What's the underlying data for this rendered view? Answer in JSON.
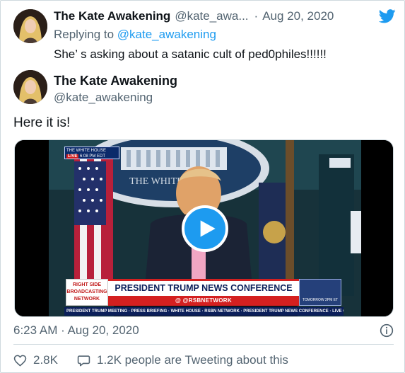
{
  "parent_tweet": {
    "display_name": "The Kate Awakening",
    "handle": "@kate_awa...",
    "separator": "·",
    "date": "Aug 20, 2020",
    "replying_label": "Replying to",
    "replying_to": "@kate_awakening",
    "text": "She’ s asking about a satanic cult of ped0philes!!!!!!"
  },
  "tweet": {
    "display_name": "The Kate Awakening",
    "handle": "@kate_awakening",
    "text": "Here it is!",
    "timestamp": "6:23 AM · Aug 20, 2020"
  },
  "video": {
    "corner_bug": "THE WHITE HOUSE",
    "bug_live": "LIVE",
    "bug_time": "6:08 PM EDT",
    "lower_third_logo": "RIGHT SIDE BROADCASTING NETWORK",
    "lower_third_title": "PRESIDENT TRUMP NEWS CONFERENCE",
    "lower_third_sub": "@ @RSBNETWORK",
    "lower_third_inset": "TOMORROW 2PM ET",
    "ticker": "PRESIDENT TRUMP MEETING · PRESS BRIEFING · WHITE HOUSE · RSBN NETWORK · PRESIDENT TRUMP NEWS CONFERENCE · LIVE COVERAGE"
  },
  "engagement": {
    "likes": "2.8K",
    "tweeting": "1.2K people are Tweeting about this"
  },
  "colors": {
    "accent": "#1d9bf0",
    "secondary_text": "#536471",
    "primary_text": "#0f1419",
    "divider": "#cfd9de"
  },
  "icons": {
    "brand": "twitter-bird-icon",
    "info": "info-icon",
    "like": "heart-icon",
    "tweeting": "speech-bubble-icon",
    "play": "play-icon"
  }
}
